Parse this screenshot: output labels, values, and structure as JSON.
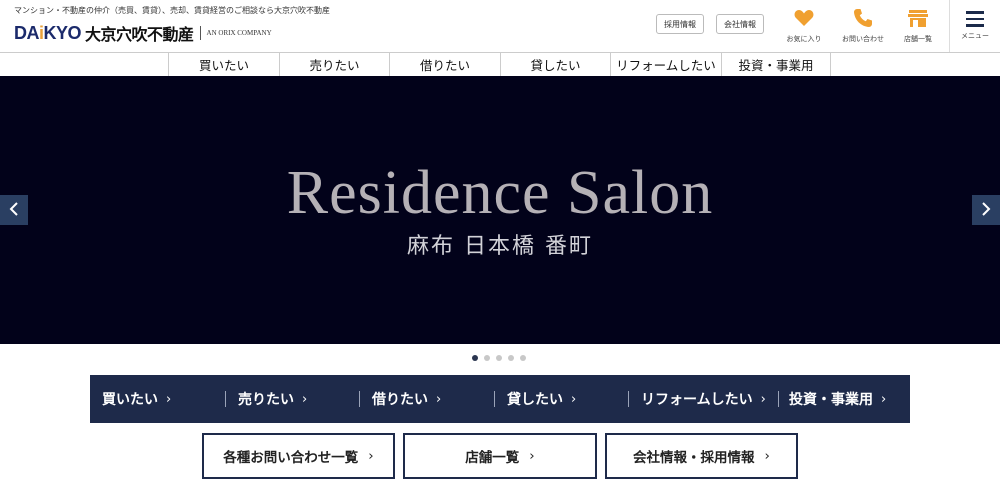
{
  "header": {
    "tagline": "マンション・不動産の仲介（売買、賃貸）、売却、賃貸経営のご相談なら大京穴吹不動産",
    "logo": {
      "daikyo": "DAIKYO",
      "jp_name": "大京穴吹不動産",
      "orix": "AN ORIX COMPANY"
    },
    "buttons": {
      "recruit": "採用情報",
      "company": "会社情報"
    },
    "icons": {
      "favorite": {
        "label": "お気に入り",
        "icon": "heart-icon"
      },
      "contact": {
        "label": "お問い合わせ",
        "icon": "phone-icon"
      },
      "stores": {
        "label": "店舗一覧",
        "icon": "store-icon"
      },
      "menu": {
        "label": "メニュー",
        "icon": "hamburger-icon"
      }
    }
  },
  "nav": {
    "items": [
      {
        "label": "買いたい"
      },
      {
        "label": "売りたい"
      },
      {
        "label": "借りたい"
      },
      {
        "label": "貸したい"
      },
      {
        "label": "リフォームしたい"
      },
      {
        "label": "投資・事業用"
      }
    ]
  },
  "hero": {
    "title": "Residence Salon",
    "subtitle": "麻布 日本橋 番町",
    "slide_count": 5,
    "active_slide": 1
  },
  "category_bar": {
    "items": [
      {
        "label": "買いたい"
      },
      {
        "label": "売りたい"
      },
      {
        "label": "借りたい"
      },
      {
        "label": "貸したい"
      },
      {
        "label": "リフォームしたい"
      },
      {
        "label": "投資・事業用"
      }
    ]
  },
  "bottom_buttons": {
    "inquiries": "各種お問い合わせ一覧",
    "stores": "店舗一覧",
    "company": "会社情報・採用情報"
  },
  "colors": {
    "navy": "#1e2a4a",
    "accent_orange": "#e8a03a",
    "hero_bg": "#02021a"
  }
}
